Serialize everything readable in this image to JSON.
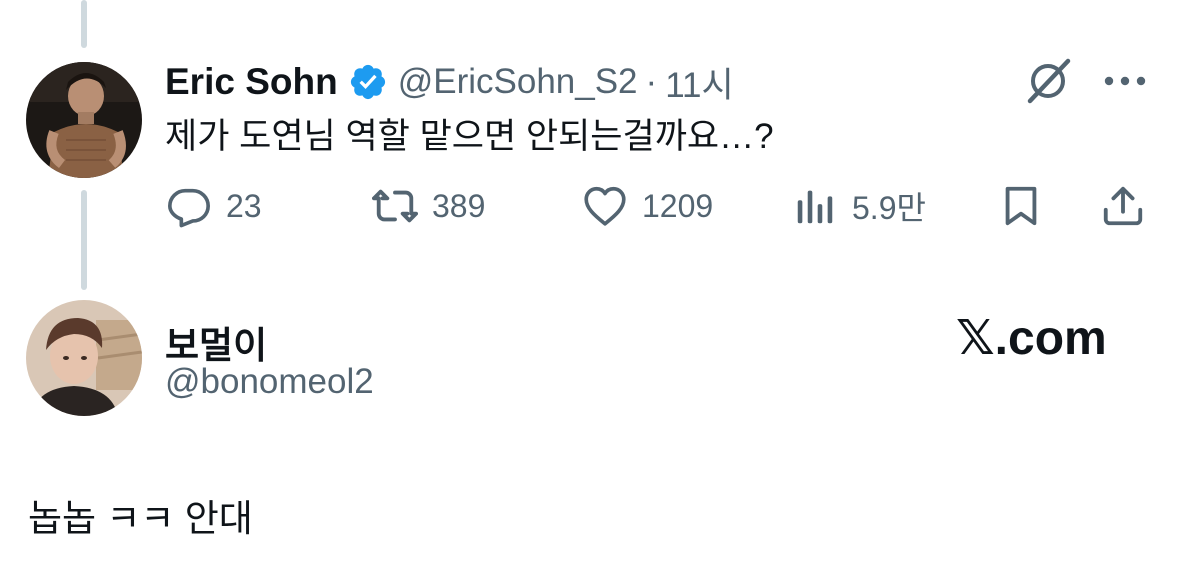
{
  "tweet": {
    "author_name": "Eric Sohn",
    "verified": true,
    "handle": "@EricSohn_S2",
    "separator": "·",
    "time": "11시",
    "text": "제가 도연님 역할 맡으면 안되는걸까요…?",
    "icons": {
      "grok": "grok-icon",
      "more": "more-icon"
    },
    "actions": {
      "replies": "23",
      "reposts": "389",
      "likes": "1209",
      "views": "5.9만"
    }
  },
  "reply_user": {
    "name": "보멀이",
    "handle": "@bonomeol2"
  },
  "brand": "𝕏.com",
  "reply_text": "놉놉 ㅋㅋ 안대",
  "colors": {
    "text": "#0f1419",
    "secondary": "#536471",
    "verified_blue": "#1d9bf0",
    "thread_line": "#cfd9de"
  }
}
